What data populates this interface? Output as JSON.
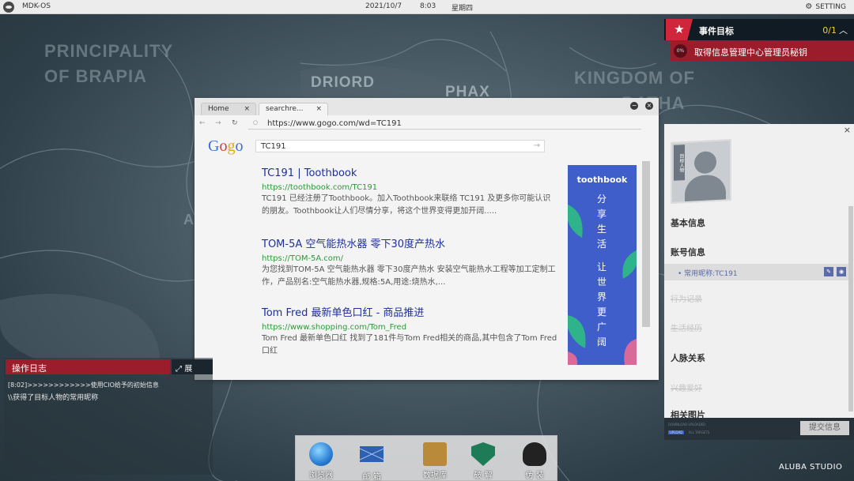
{
  "topbar": {
    "os_name": "MDK-OS",
    "date": "2021/10/7",
    "time": "8:03",
    "weekday": "星期四",
    "setting": "SETTING"
  },
  "background": {
    "map_labels": [
      "PRINCIPALITY",
      "OF BRAPIA",
      "DRIORD",
      "PHAX",
      "KINGDOM OF",
      "BATHA",
      "A"
    ]
  },
  "event_goal": {
    "title": "事件目标",
    "progress": "0/1",
    "item_percent": "0%",
    "item_text": "取得信息管理中心管理员秘钥"
  },
  "browser": {
    "tabs": [
      {
        "label": "Home"
      },
      {
        "label": "searchre..."
      }
    ],
    "url": "https://www.gogo.com/wd=TC191",
    "logo": [
      "G",
      "o",
      "g",
      "o"
    ],
    "query": "TC191",
    "results": [
      {
        "title": "TC191 | Toothbook",
        "url": "https://toothbook.com/TC191",
        "desc": "TC191 已经注册了Toothbook。加入Toothbook来联络 TC191 及更多你可能认识的朋友。Toothbook让人们尽情分享，将这个世界变得更加开阔....."
      },
      {
        "title": "TOM-5A 空气能热水器 零下30度产热水",
        "url": "https://TOM-5A.com/",
        "desc": "为您找到TOM-5A 空气能热水器 零下30度产热水 安装空气能热水工程等加工定制工作，产品别名:空气能热水器,规格:5A,用途:烧热水,..."
      },
      {
        "title": "Tom Fred 最新单色口红 - 商品推进",
        "url": "https://www.shopping.com/Tom_Fred",
        "desc": "Tom Fred 最新单色口红 找到了181件与Tom Fred相关的商品,其中包含了Tom Fred口红"
      }
    ],
    "ad": {
      "brand": "toothbook",
      "slogan": [
        "分",
        "享",
        "生",
        "活",
        "",
        "让",
        "世",
        "界",
        "更",
        "广",
        "阔"
      ]
    }
  },
  "log_panel": {
    "title": "操作日志",
    "expand_label": "展",
    "lines": [
      "[8:02]>>>>>>>>>>>>使用CIO给予的初始信息",
      "\\\\获得了目标人物的常用昵称"
    ]
  },
  "profile": {
    "photo_tag": "目标人物",
    "sections": {
      "basic": "基本信息",
      "account": "账号信息",
      "selected_item": "• 常用昵称:TC191",
      "behavior": "行为记录",
      "life": "生活经历",
      "relations": "人脉关系",
      "hobbies": "兴趣爱好",
      "photos": "相关图片"
    },
    "footer_line1": "DOWNLOAD  UPLOADED",
    "footer_upload": "UPLOAD",
    "footer_line2": "  ALL TARGETS",
    "submit": "提交信息"
  },
  "dock": {
    "items": [
      {
        "label": "浏览器",
        "icon": "globe-icon"
      },
      {
        "label": "邮 箱",
        "icon": "mail-icon"
      },
      {
        "label": "数据库",
        "icon": "database-icon"
      },
      {
        "label": "破 解",
        "icon": "shield-icon"
      },
      {
        "label": "伪 装",
        "icon": "hacker-icon"
      }
    ]
  },
  "studio": "ALUBA STUDIO",
  "colors": {
    "accent_red": "#9b1c2a",
    "star_red": "#d0263b",
    "link_blue": "#1e2f9c",
    "url_green": "#2b9a3a",
    "ad_blue": "#3f5ec9",
    "goal_yellow": "#f5d03a"
  }
}
